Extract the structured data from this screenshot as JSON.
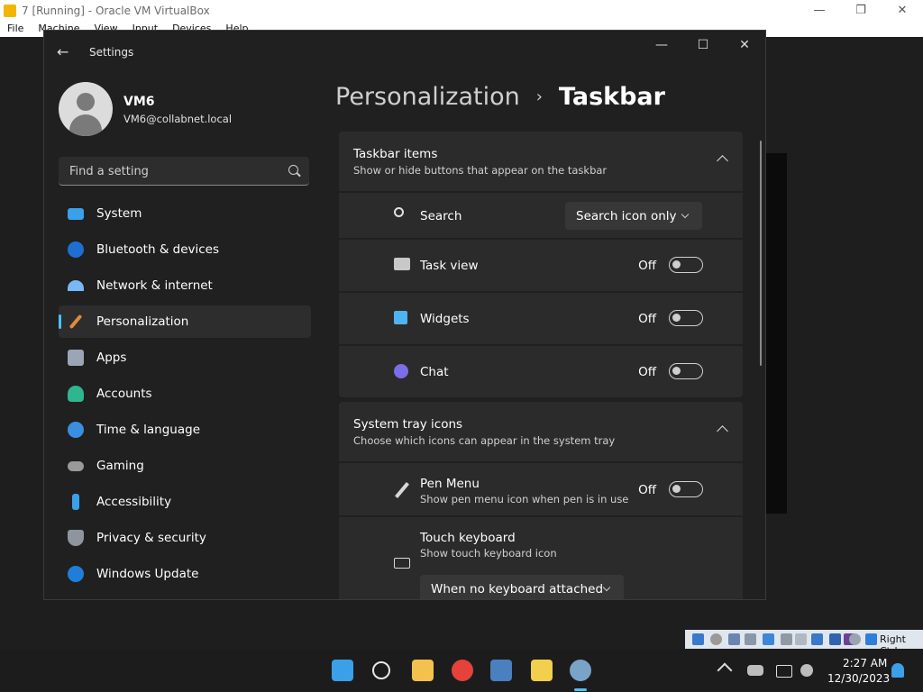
{
  "host": {
    "title": "7 [Running] - Oracle VM VirtualBox",
    "menu": [
      "File",
      "Machine",
      "View",
      "Input",
      "Devices",
      "Help"
    ],
    "window_controls": [
      "—",
      "❐",
      "✕"
    ],
    "host_key_label": "Right Ctrl"
  },
  "window": {
    "app_title": "Settings",
    "back_glyph": "←",
    "controls": [
      "—",
      "☐",
      "✕"
    ]
  },
  "user": {
    "name": "VM6",
    "email": "VM6@collabnet.local"
  },
  "search": {
    "placeholder": "Find a setting"
  },
  "nav": {
    "items": [
      {
        "label": "System",
        "icon": "monitor-icon",
        "color": "#3aa0e8",
        "selected": false
      },
      {
        "label": "Bluetooth & devices",
        "icon": "bluetooth-icon",
        "color": "#1f6fd1",
        "selected": false
      },
      {
        "label": "Network & internet",
        "icon": "wifi-icon",
        "color": "#7ab7f5",
        "selected": false
      },
      {
        "label": "Personalization",
        "icon": "brush-icon",
        "color": "#e08a3c",
        "selected": true
      },
      {
        "label": "Apps",
        "icon": "apps-icon",
        "color": "#9aa6b5",
        "selected": false
      },
      {
        "label": "Accounts",
        "icon": "person-icon",
        "color": "#2fb58f",
        "selected": false
      },
      {
        "label": "Time & language",
        "icon": "globe-clock-icon",
        "color": "#3a8fe0",
        "selected": false
      },
      {
        "label": "Gaming",
        "icon": "controller-icon",
        "color": "#9a9a9a",
        "selected": false
      },
      {
        "label": "Accessibility",
        "icon": "accessibility-icon",
        "color": "#3aa0e8",
        "selected": false
      },
      {
        "label": "Privacy & security",
        "icon": "shield-icon",
        "color": "#8e959e",
        "selected": false
      },
      {
        "label": "Windows Update",
        "icon": "update-icon",
        "color": "#1f7fd8",
        "selected": false
      }
    ]
  },
  "breadcrumb": {
    "parent": "Personalization",
    "separator": "›",
    "current": "Taskbar"
  },
  "taskbar_items": {
    "title": "Taskbar items",
    "subtitle": "Show or hide buttons that appear on the taskbar",
    "search": {
      "label": "Search",
      "value": "Search icon only"
    },
    "task_view": {
      "label": "Task view",
      "state": "Off"
    },
    "widgets": {
      "label": "Widgets",
      "state": "Off"
    },
    "chat": {
      "label": "Chat",
      "state": "Off"
    }
  },
  "system_tray": {
    "title": "System tray icons",
    "subtitle": "Choose which icons can appear in the system tray",
    "pen_menu": {
      "label": "Pen Menu",
      "subtitle": "Show pen menu icon when pen is in use",
      "state": "Off"
    },
    "touch_keyboard": {
      "label": "Touch keyboard",
      "subtitle": "Show touch keyboard icon",
      "value": "When no keyboard attached"
    }
  },
  "clock": {
    "time": "2:27 AM",
    "date": "12/30/2023"
  },
  "colors": {
    "accent": "#4cc2ff",
    "card": "#2b2b2b",
    "window_bg": "#202020"
  }
}
